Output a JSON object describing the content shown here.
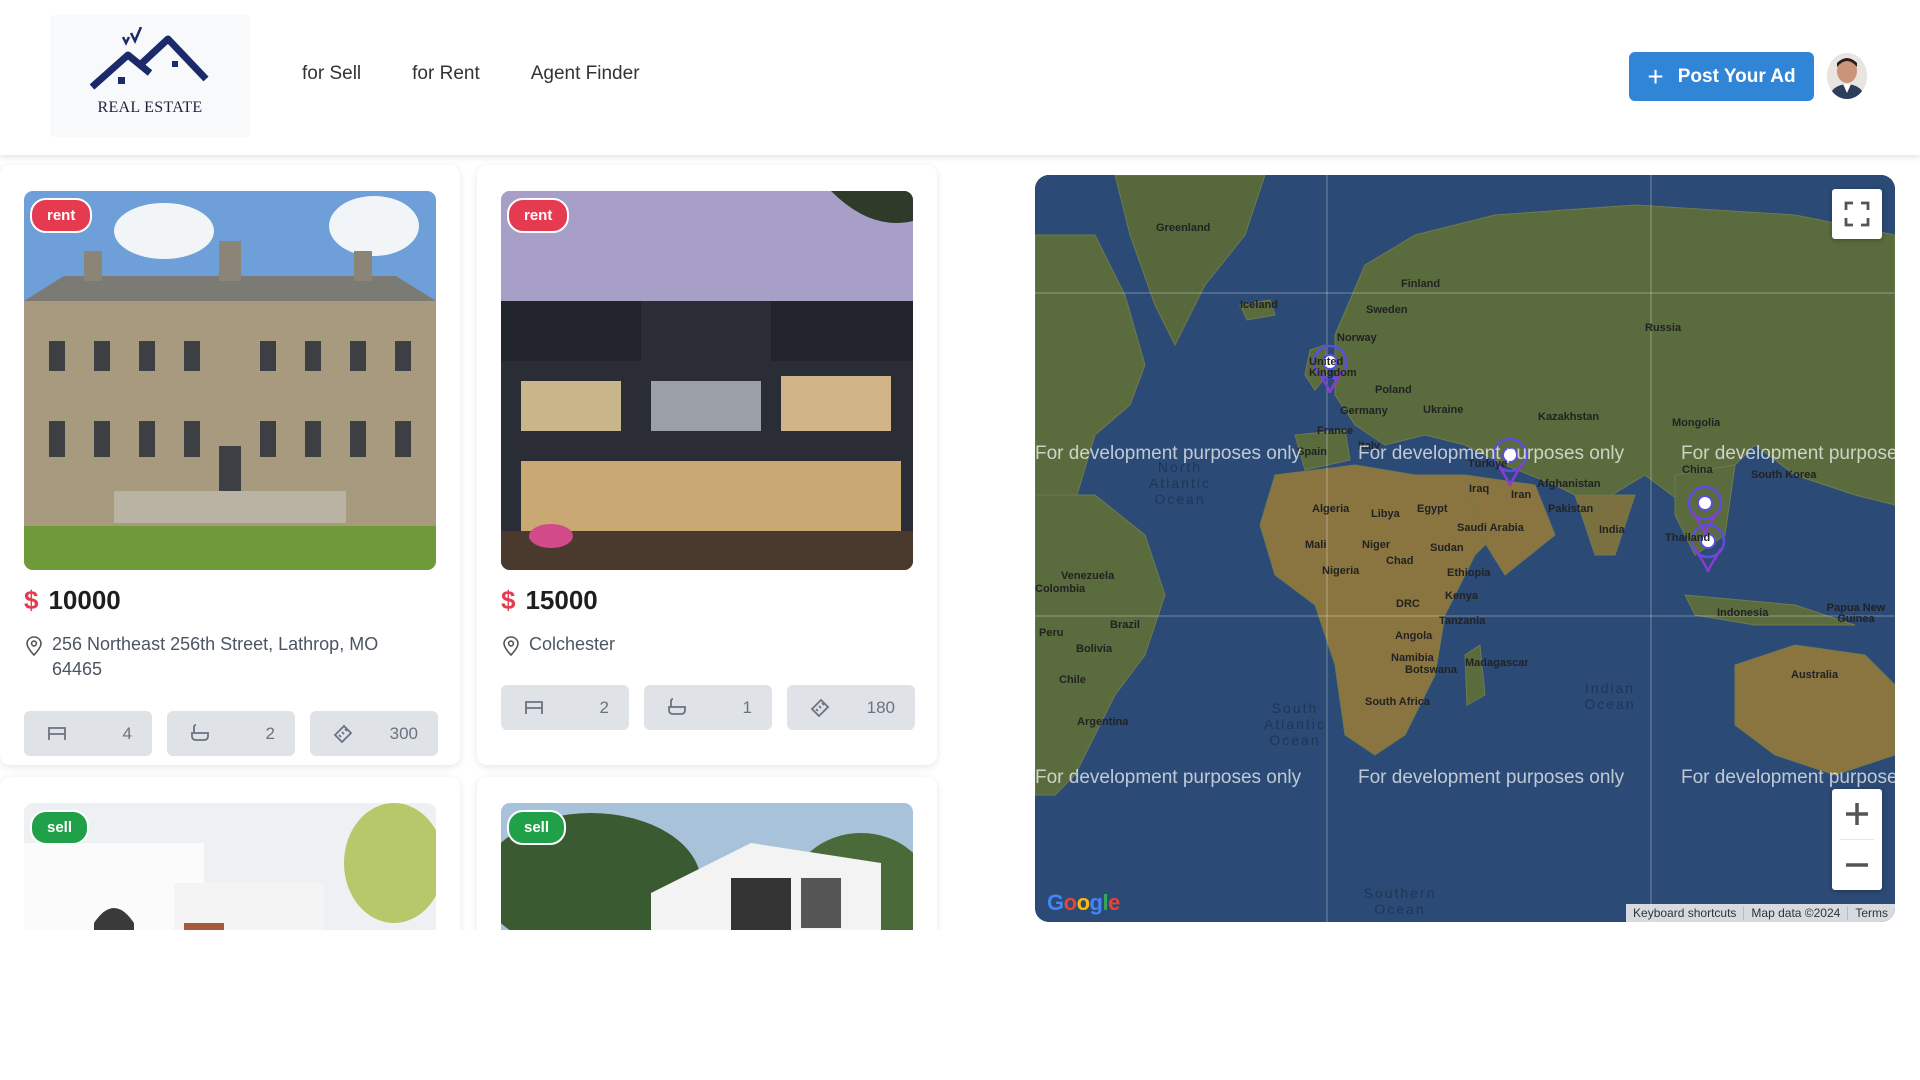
{
  "header": {
    "logo_text": "REAL ESTATE",
    "nav": [
      "for Sell",
      "for Rent",
      "Agent Finder"
    ],
    "post_button_label": "Post Your Ad"
  },
  "currency_symbol": "$",
  "listings": [
    {
      "badge": "rent",
      "price": "10000",
      "address": "256 Northeast 256th Street, Lathrop, MO 64465",
      "beds": "4",
      "baths": "2",
      "area": "300"
    },
    {
      "badge": "rent",
      "price": "15000",
      "address": "Colchester",
      "beds": "2",
      "baths": "1",
      "area": "180"
    },
    {
      "badge": "sell"
    },
    {
      "badge": "sell"
    }
  ],
  "map": {
    "watermark": "For development purposes only",
    "countries": [
      "Greenland",
      "Iceland",
      "Finland",
      "Sweden",
      "Norway",
      "Russia",
      "United Kingdom",
      "Poland",
      "Germany",
      "Ukraine",
      "France",
      "Kazakhstan",
      "Mongolia",
      "Spain",
      "Italy",
      "Türkiye",
      "China",
      "South Korea",
      "Afghanistan",
      "Iraq",
      "Iran",
      "Pakistan",
      "Algeria",
      "Libya",
      "Egypt",
      "Saudi Arabia",
      "India",
      "Thailand",
      "Mali",
      "Niger",
      "Chad",
      "Sudan",
      "Venezuela",
      "Colombia",
      "Nigeria",
      "Ethiopia",
      "Kenya",
      "DRC",
      "Tanzania",
      "Indonesia",
      "Papua New Guinea",
      "Peru",
      "Brazil",
      "Bolivia",
      "Angola",
      "Namibia",
      "Botswana",
      "Madagascar",
      "Australia",
      "Chile",
      "South Africa",
      "Argentina"
    ],
    "oceans": {
      "north_atlantic": "North Atlantic Ocean",
      "south_atlantic": "South Atlantic Ocean",
      "indian": "Indian Ocean",
      "southern": "Southern Ocean"
    },
    "footer": {
      "shortcuts": "Keyboard shortcuts",
      "data": "Map data ©2024",
      "terms": "Terms"
    },
    "google": "Google"
  }
}
